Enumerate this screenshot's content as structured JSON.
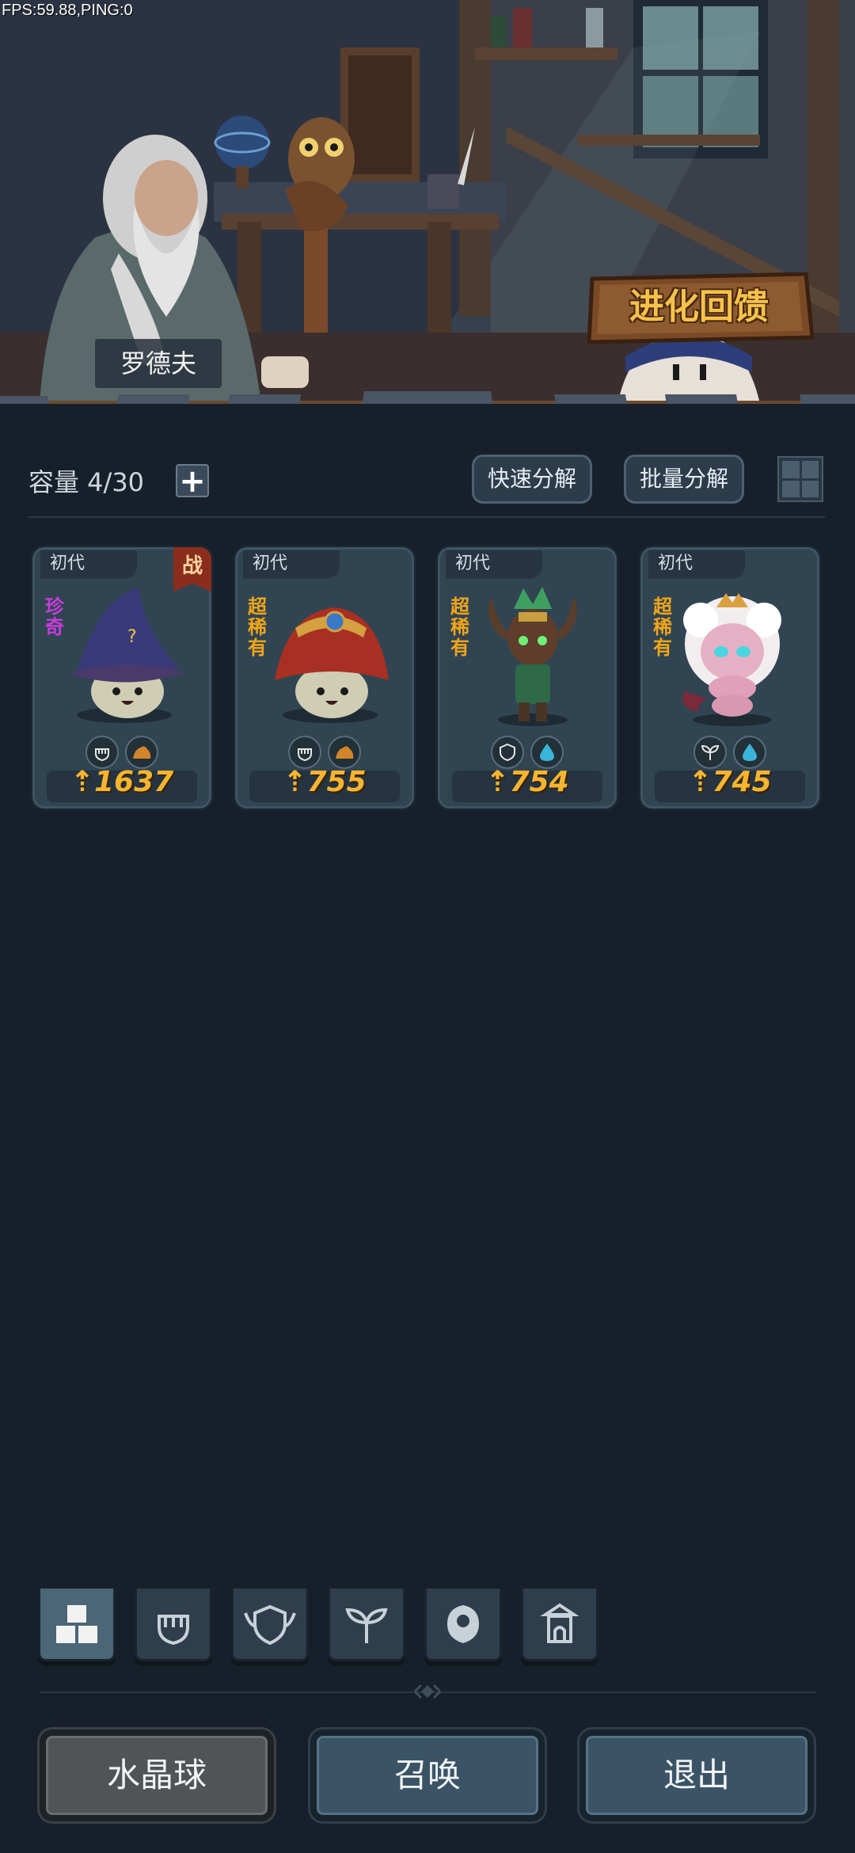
{
  "debug": {
    "fps_text": "FPS:59.88,PING:0"
  },
  "scene": {
    "npc_name": "罗德夫",
    "evolution_button": "进化回馈"
  },
  "toolbar": {
    "capacity_label": "容量 4/30",
    "add_symbol": "+",
    "quick_decompose": "快速分解",
    "batch_decompose": "批量分解"
  },
  "cards": [
    {
      "generation": "初代",
      "rarity": "珍奇",
      "rarity_color": "#c63cdc",
      "battle_badge": "战",
      "power": "1637",
      "elements": [
        "fist-icon",
        "earth-icon"
      ],
      "creature": "purple-wizard-mushroom"
    },
    {
      "generation": "初代",
      "rarity": "超稀有",
      "rarity_color": "#f2a618",
      "battle_badge": "",
      "power": "755",
      "elements": [
        "fist-icon",
        "earth-icon"
      ],
      "creature": "red-helmet-mushroom"
    },
    {
      "generation": "初代",
      "rarity": "超稀有",
      "rarity_color": "#f2a618",
      "battle_badge": "",
      "power": "754",
      "elements": [
        "shield-icon",
        "water-icon"
      ],
      "creature": "tree-knight"
    },
    {
      "generation": "初代",
      "rarity": "超稀有",
      "rarity_color": "#f2a618",
      "battle_badge": "",
      "power": "745",
      "elements": [
        "sprout-icon",
        "water-icon"
      ],
      "creature": "pink-caterpillar"
    }
  ],
  "filters": [
    "all-icon",
    "fist-icon",
    "shield-icon",
    "sprout-icon",
    "spirit-icon",
    "tower-icon"
  ],
  "bottom": {
    "crystal_ball": "水晶球",
    "summon": "召唤",
    "exit": "退出"
  },
  "colors": {
    "background": "#17202a",
    "card": "#314452",
    "power": "#f5b531",
    "rarity_super": "#f2a618",
    "rarity_exotic": "#c63cdc"
  }
}
